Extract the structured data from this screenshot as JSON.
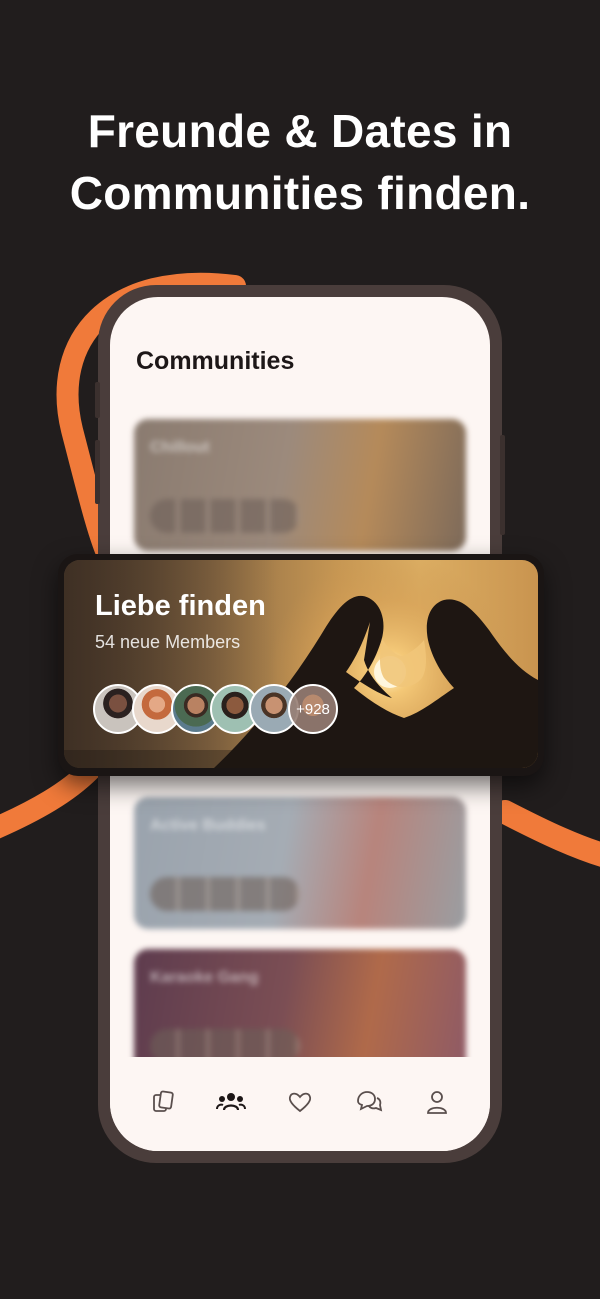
{
  "headline": {
    "line1": "Freunde & Dates in",
    "line2": "Communities finden."
  },
  "screen": {
    "title": "Communities",
    "blurred_cards": [
      {
        "title": "Chillout",
        "color": "#8d7a6c"
      },
      {
        "title": "Active Buddies",
        "color": "#8a93a0"
      },
      {
        "title": "Karaoke Gang",
        "color": "#6b4a5e"
      }
    ]
  },
  "featured": {
    "title": "Liebe finden",
    "subtitle": "54 neue Members",
    "more_count": "+928"
  },
  "tabbar": {
    "items": [
      {
        "icon": "cards-icon"
      },
      {
        "icon": "community-icon",
        "active": true
      },
      {
        "icon": "heart-icon"
      },
      {
        "icon": "chat-icon"
      },
      {
        "icon": "profile-icon"
      }
    ]
  },
  "colors": {
    "background": "#211d1d",
    "accent": "#f07a3a",
    "screen": "#fdf6f3"
  }
}
